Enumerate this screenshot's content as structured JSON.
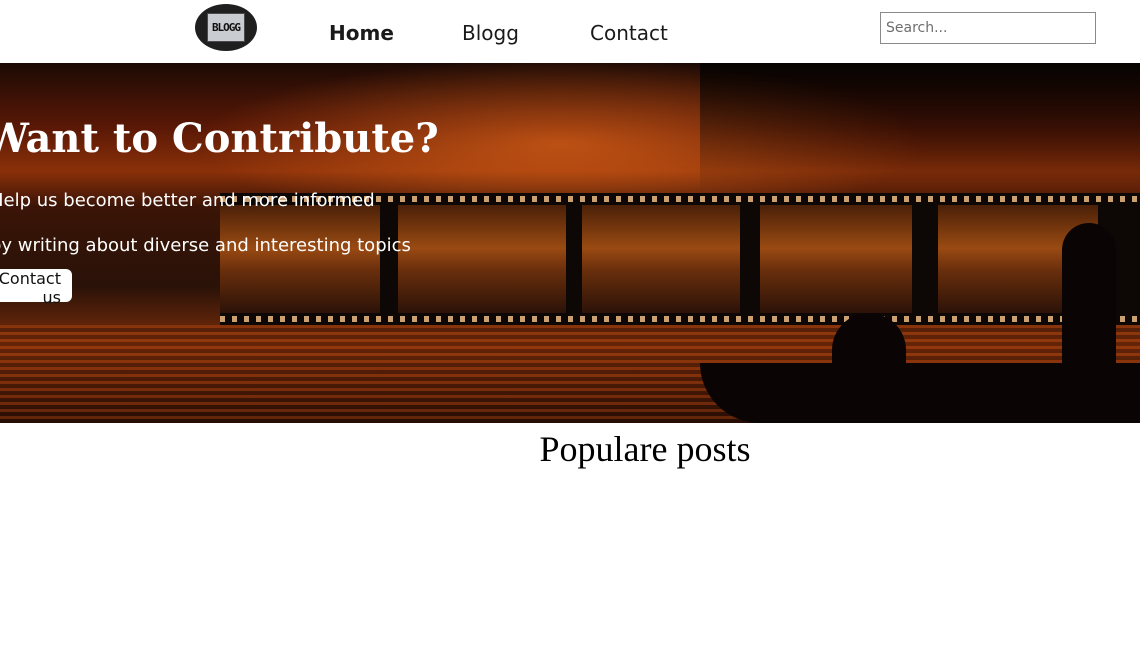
{
  "header": {
    "logo_text": "BLOGG",
    "nav": {
      "home": "Home",
      "blogg": "Blogg",
      "contact": "Contact"
    },
    "search_placeholder": "Search..."
  },
  "hero": {
    "title": "Want to Contribute?",
    "line1": "Help us become better and more informed",
    "line2": "by writing about diverse and interesting topics",
    "button": "Contact us"
  },
  "main": {
    "section_title": "Populare posts"
  }
}
